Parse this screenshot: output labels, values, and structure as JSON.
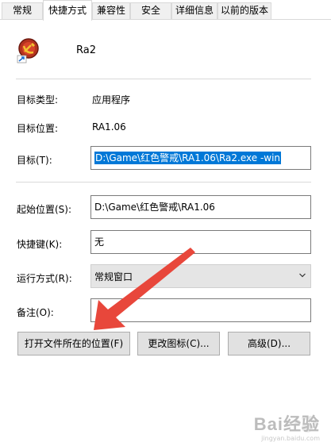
{
  "tabs": [
    "常规",
    "快捷方式",
    "兼容性",
    "安全",
    "详细信息",
    "以前的版本"
  ],
  "active_tab": "快捷方式",
  "app": {
    "name": "Ra2",
    "icon": "red-alert-sickle-hammer-icon"
  },
  "fields": {
    "target_type": {
      "label": "目标类型:",
      "value": "应用程序"
    },
    "target_location": {
      "label": "目标位置:",
      "value": "RA1.06"
    },
    "target": {
      "label": "目标(T):",
      "value": "D:\\Game\\红色警戒\\RA1.06\\Ra2.exe -win"
    },
    "start_in": {
      "label": "起始位置(S):",
      "value": "D:\\Game\\红色警戒\\RA1.06"
    },
    "shortcut_key": {
      "label": "快捷键(K):",
      "value": "无"
    },
    "run": {
      "label": "运行方式(R):",
      "value": "常规窗口"
    },
    "comment": {
      "label": "备注(O):",
      "value": ""
    }
  },
  "buttons": {
    "open_location": "打开文件所在的位置(F)",
    "change_icon": "更改图标(C)...",
    "advanced": "高级(D)..."
  },
  "annotation": {
    "arrow_color": "#e8473b"
  },
  "watermark": {
    "text": "Bai经验",
    "url": "jingyan.baidu.com"
  }
}
